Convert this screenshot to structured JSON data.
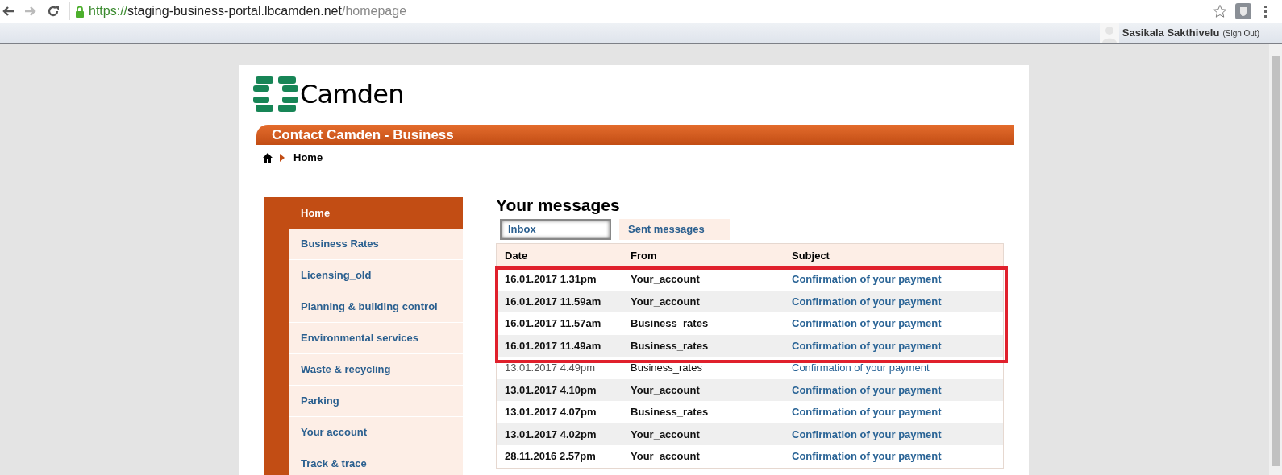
{
  "browser": {
    "url_scheme": "https://",
    "url_host": "staging-business-portal.lbcamden.net",
    "url_path": "/homepage"
  },
  "user_bar": {
    "name": "Sasikala Sakthivelu",
    "sign_out": "(Sign Out)"
  },
  "logo": {
    "text": "Camden"
  },
  "banner": {
    "title": "Contact Camden - Business"
  },
  "breadcrumb": {
    "items": [
      "Home"
    ]
  },
  "sidebar": {
    "items": [
      {
        "label": "Home",
        "selected": true
      },
      {
        "label": "Business Rates",
        "selected": false
      },
      {
        "label": "Licensing_old",
        "selected": false
      },
      {
        "label": "Planning & building control",
        "selected": false
      },
      {
        "label": "Environmental services",
        "selected": false
      },
      {
        "label": "Waste & recycling",
        "selected": false
      },
      {
        "label": "Parking",
        "selected": false
      },
      {
        "label": "Your account",
        "selected": false
      },
      {
        "label": "Track & trace",
        "selected": false
      }
    ]
  },
  "messages": {
    "title": "Your messages",
    "tabs": [
      {
        "label": "Inbox",
        "selected": true
      },
      {
        "label": "Sent messages",
        "selected": false
      }
    ],
    "columns": [
      "Date",
      "From",
      "Subject"
    ],
    "rows": [
      {
        "date": "16.01.2017 1.31pm",
        "from": "Your_account",
        "subject": "Confirmation of your payment",
        "unread": true
      },
      {
        "date": "16.01.2017 11.59am",
        "from": "Your_account",
        "subject": "Confirmation of your payment",
        "unread": true
      },
      {
        "date": "16.01.2017 11.57am",
        "from": "Business_rates",
        "subject": "Confirmation of your payment",
        "unread": true
      },
      {
        "date": "16.01.2017 11.49am",
        "from": "Business_rates",
        "subject": "Confirmation of your payment",
        "unread": true
      },
      {
        "date": "13.01.2017 4.49pm",
        "from": "Business_rates",
        "subject": "Confirmation of your payment",
        "unread": false
      },
      {
        "date": "13.01.2017 4.10pm",
        "from": "Your_account",
        "subject": "Confirmation of your payment",
        "unread": true
      },
      {
        "date": "13.01.2017 4.07pm",
        "from": "Business_rates",
        "subject": "Confirmation of your payment",
        "unread": true
      },
      {
        "date": "13.01.2017 4.02pm",
        "from": "Your_account",
        "subject": "Confirmation of your payment",
        "unread": true
      },
      {
        "date": "28.11.2016 2.57pm",
        "from": "Your_account",
        "subject": "Confirmation of your payment",
        "unread": true
      }
    ]
  }
}
